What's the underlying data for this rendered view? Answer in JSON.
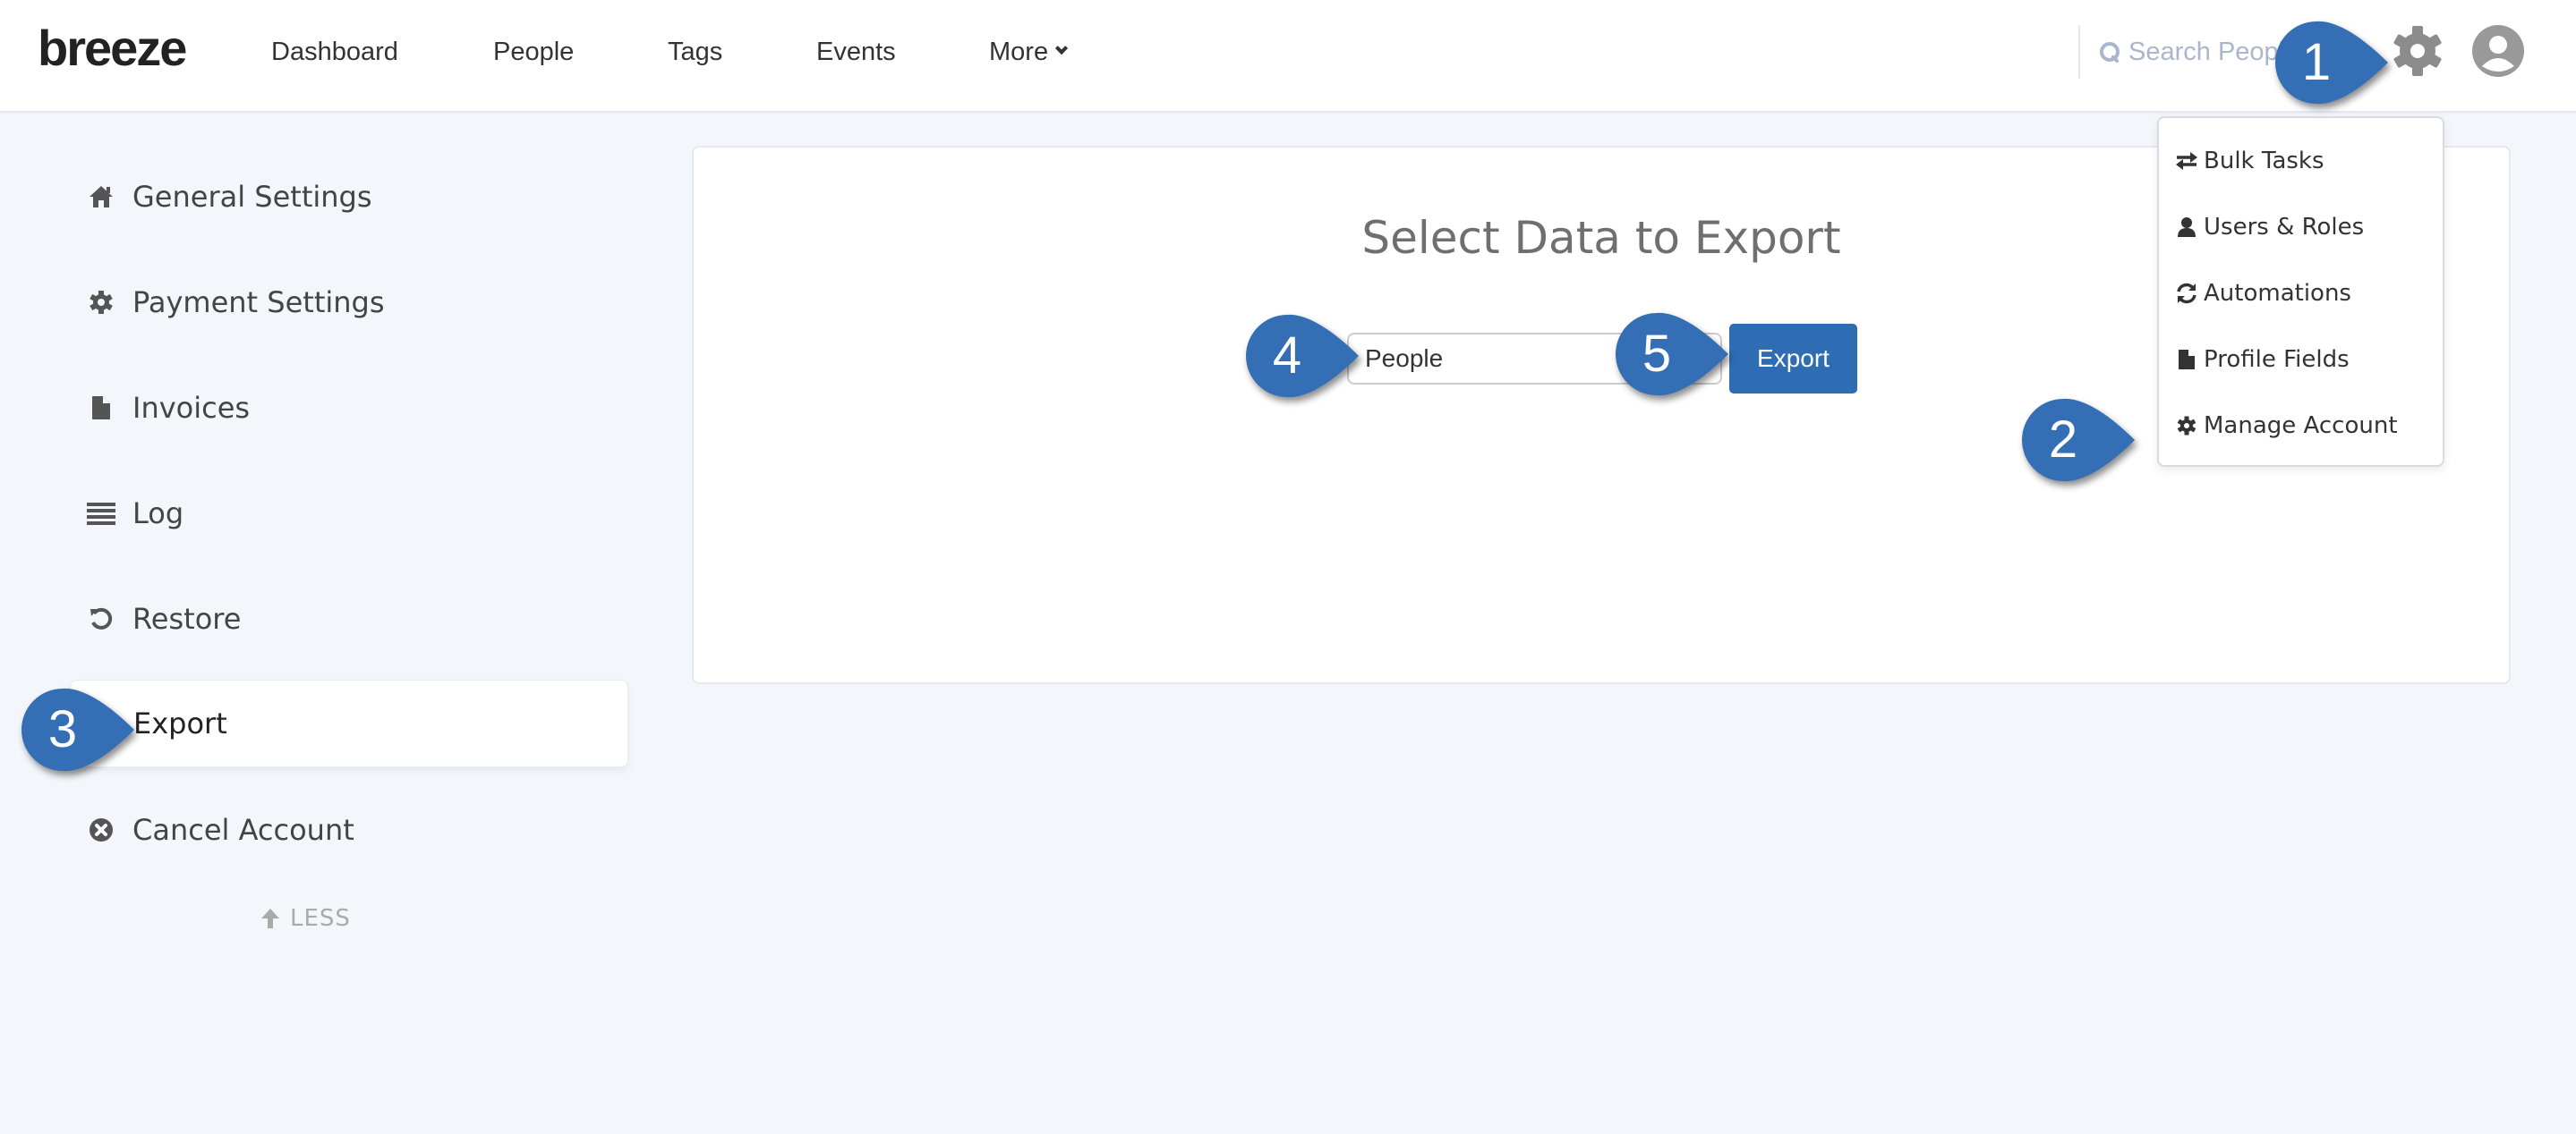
{
  "header": {
    "logo": "breeze",
    "nav": [
      {
        "label": "Dashboard"
      },
      {
        "label": "People"
      },
      {
        "label": "Tags"
      },
      {
        "label": "Events"
      },
      {
        "label": "More"
      }
    ],
    "search": {
      "placeholder": "Search People",
      "value": ""
    },
    "settings_icon": "gear-icon",
    "user_icon": "user-circle-icon"
  },
  "sidebar": {
    "items": [
      {
        "label": "General Settings",
        "icon": "home-icon"
      },
      {
        "label": "Payment Settings",
        "icon": "gear-icon"
      },
      {
        "label": "Invoices",
        "icon": "file-icon"
      },
      {
        "label": "Log",
        "icon": "list-icon"
      },
      {
        "label": "Restore",
        "icon": "undo-icon"
      },
      {
        "label": "Export",
        "icon": "",
        "active": true
      },
      {
        "label": "Cancel Account",
        "icon": "times-circle-icon"
      }
    ],
    "less_label": "LESS"
  },
  "main": {
    "title": "Select Data to Export",
    "select_value": "People",
    "export_button": "Export"
  },
  "settings_menu": {
    "items": [
      {
        "label": "Bulk Tasks",
        "icon": "exchange-icon"
      },
      {
        "label": "Users & Roles",
        "icon": "user-icon"
      },
      {
        "label": "Automations",
        "icon": "refresh-icon"
      },
      {
        "label": "Profile Fields",
        "icon": "file-icon"
      },
      {
        "label": "Manage Account",
        "icon": "gear-icon"
      }
    ]
  },
  "callouts": [
    "1",
    "2",
    "3",
    "4",
    "5"
  ],
  "colors": {
    "accent": "#2e6db4",
    "callout": "#346fb5",
    "background": "#f3f7fb",
    "icon_gray": "#8c8c8c"
  }
}
